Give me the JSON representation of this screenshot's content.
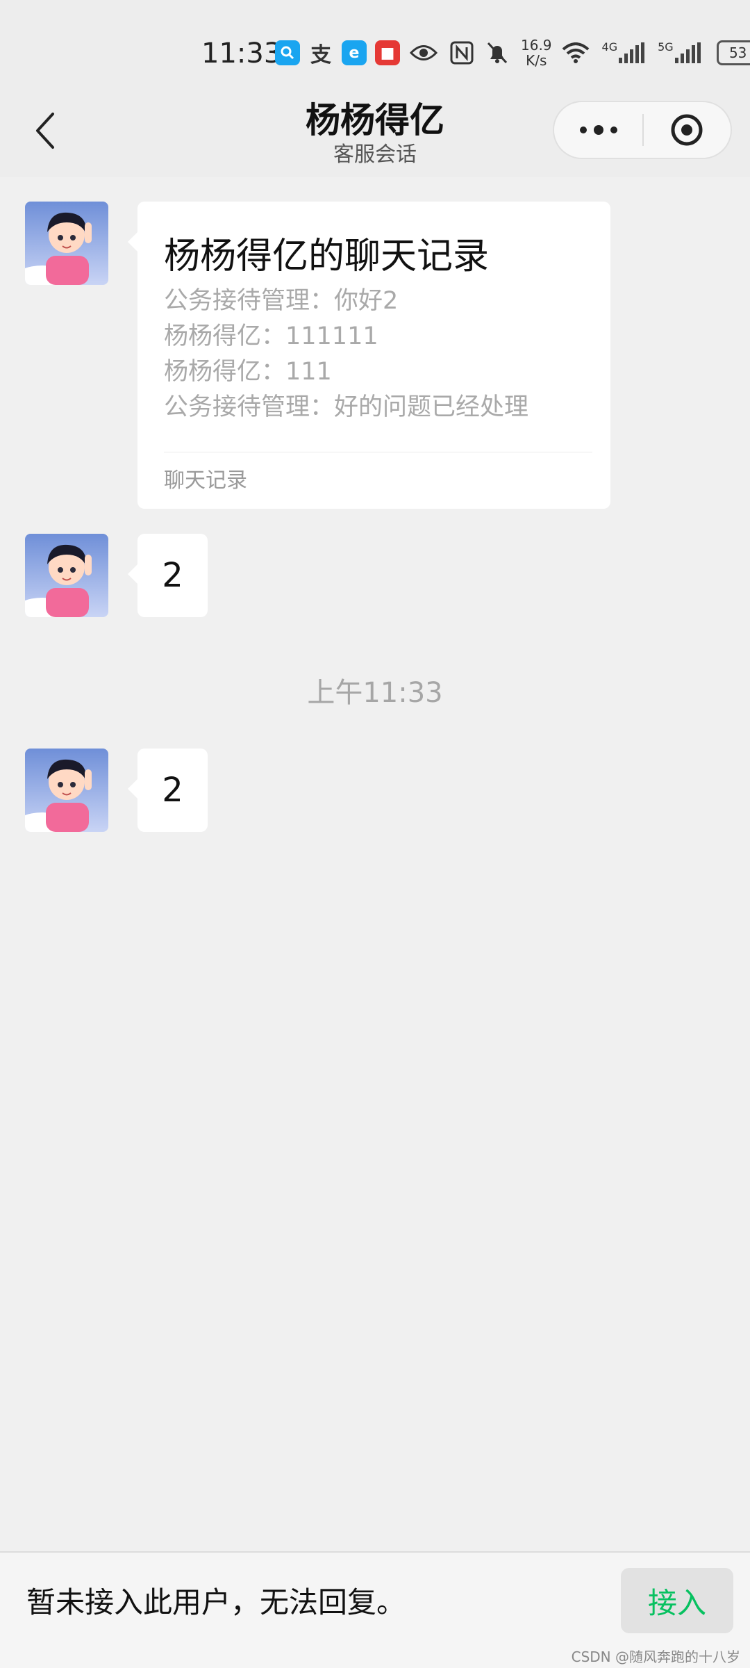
{
  "status_bar": {
    "time": "11:33",
    "speed_value": "16.9",
    "speed_unit": "K/s",
    "net_a": "4G",
    "net_b": "5G",
    "battery": "53",
    "app_icons": [
      "search-app-icon",
      "alipay-icon",
      "e-app-icon",
      "red-app-icon"
    ],
    "sys_icons": [
      "eye-icon",
      "nfc-icon",
      "bell-muted-icon",
      "wifi-icon"
    ]
  },
  "header": {
    "title": "杨杨得亿",
    "subtitle": "客服会话"
  },
  "chat_record_card": {
    "title": "杨杨得亿的聊天记录",
    "lines": [
      "公务接待管理：你好2",
      "杨杨得亿：111111",
      "杨杨得亿：111",
      "公务接待管理：好的问题已经处理"
    ],
    "footer": "聊天记录"
  },
  "messages": [
    {
      "text": "2"
    },
    {
      "text": "2"
    }
  ],
  "timestamp": "上午11:33",
  "bottom_bar": {
    "notice": "暂未接入此用户，无法回复。",
    "join_label": "接入",
    "watermark": "CSDN @随风奔跑的十八岁"
  },
  "colors": {
    "accent_green": "#07c160",
    "background": "#f0f0f0",
    "bubble": "#ffffff",
    "muted_text": "#a9a9a9"
  }
}
